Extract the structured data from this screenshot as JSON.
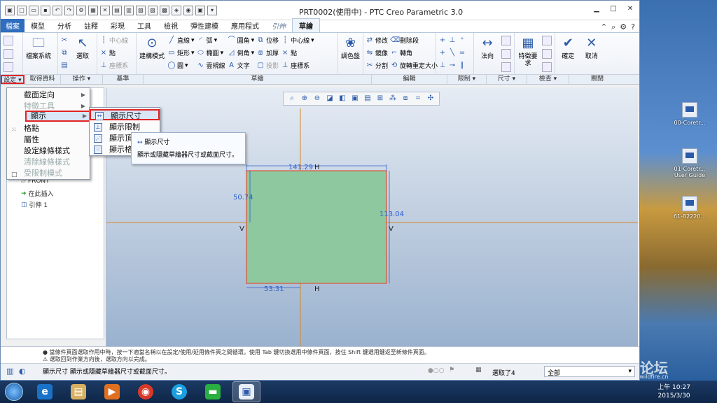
{
  "window": {
    "title": "PRT0002(使用中) - PTC Creo Parametric 3.0"
  },
  "tabs": [
    {
      "label": "檔案"
    },
    {
      "label": "模型"
    },
    {
      "label": "分析"
    },
    {
      "label": "註釋"
    },
    {
      "label": "彩現"
    },
    {
      "label": "工具"
    },
    {
      "label": "檢視"
    },
    {
      "label": "彈性建模"
    },
    {
      "label": "應用程式"
    },
    {
      "label": "引伸"
    },
    {
      "label": "草繪"
    }
  ],
  "ribbon": {
    "file_system": "檔案系統",
    "select": "選取",
    "centerline1": "中心線",
    "point1": "點",
    "coordsys1": "座標系",
    "construction_mode": "建構模式",
    "line": "直線",
    "arc": "弧",
    "fillet": "圓角",
    "offset": "位移",
    "centerline2": "中心線",
    "modify": "修改",
    "delete_segment": "刪除段",
    "rectangle": "矩形",
    "ellipse": "橢圓",
    "chamfer": "倒角",
    "thicken": "加厚",
    "point2": "點",
    "mirror": "鏡像",
    "corner": "轉角",
    "circle": "圓",
    "spline": "雲規線",
    "text": "文字",
    "project": "投影",
    "coordsys2": "座標系",
    "palette": "調色盤",
    "divide": "分割",
    "rotate_resize": "旋轉重定大小",
    "normal": "法向",
    "feature_req": "特徵要求",
    "ok": "確定",
    "cancel": "取消"
  },
  "groups": {
    "setup": "設定",
    "get_data": "取得資料",
    "operations": "操作",
    "datum": "基準",
    "sketch": "草繪",
    "edit": "編輯",
    "constrain": "限制",
    "dimension": "尺寸",
    "inspect": "檢查",
    "close": "關閉"
  },
  "menu": {
    "items": [
      {
        "label": "截面定向"
      },
      {
        "label": "特徵工具"
      },
      {
        "label": "顯示"
      },
      {
        "label": "格點"
      },
      {
        "label": "屬性"
      },
      {
        "label": "設定線條樣式"
      },
      {
        "label": "清除線條樣式"
      },
      {
        "label": "受限制模式"
      }
    ]
  },
  "submenu": {
    "items": [
      {
        "label": "顯示尺寸"
      },
      {
        "label": "顯示限制"
      },
      {
        "label": "顯示頂點"
      },
      {
        "label": "顯示格點"
      }
    ]
  },
  "tooltip": {
    "title": "顯示尺寸",
    "body": "顯示或隱藏草繪器尺寸或截面尺寸。"
  },
  "tree": {
    "front": "FRONT",
    "insert_here": "在此插入",
    "extrude": "引伸 1"
  },
  "sketch": {
    "dim_top": "141.29",
    "dim_left": "50.74",
    "dim_right": "113.04",
    "dim_bottom": "53.31",
    "h": "H",
    "v": "V"
  },
  "message": {
    "line1": "● 當條件頁面選取作用中時，按一下適當名稱以在設定/使用/延用條件頁之間循環。使用 Tab 鍵切換選用中條件頁面，按住 Shift 鍵選用鍵返至新條件頁面。",
    "line2": "⚠ 選取回到作業方向後，選取方向以完成。"
  },
  "status": {
    "text": "顯示尺寸 顯示或隱藏草繪器尺寸或截面尺寸。",
    "selected": "選取了4",
    "filter": "全部"
  },
  "desktop": {
    "icons": [
      {
        "label": "00-Coretr..."
      },
      {
        "label": "01-Coretr... User Guide"
      },
      {
        "label": "61-82220..."
      }
    ],
    "watermark": "野火论坛",
    "watermark_sub": "www.proewildfire.cn"
  },
  "clock": {
    "time": "上午 10:27",
    "date": "2015/3/30"
  },
  "colors": {
    "sketch_fill": "#8ec89e",
    "sketch_edge": "#e0503a",
    "dim_color": "#2f5fd0",
    "axis_orange": "#d4882a",
    "highlight_red": "#e02424"
  }
}
